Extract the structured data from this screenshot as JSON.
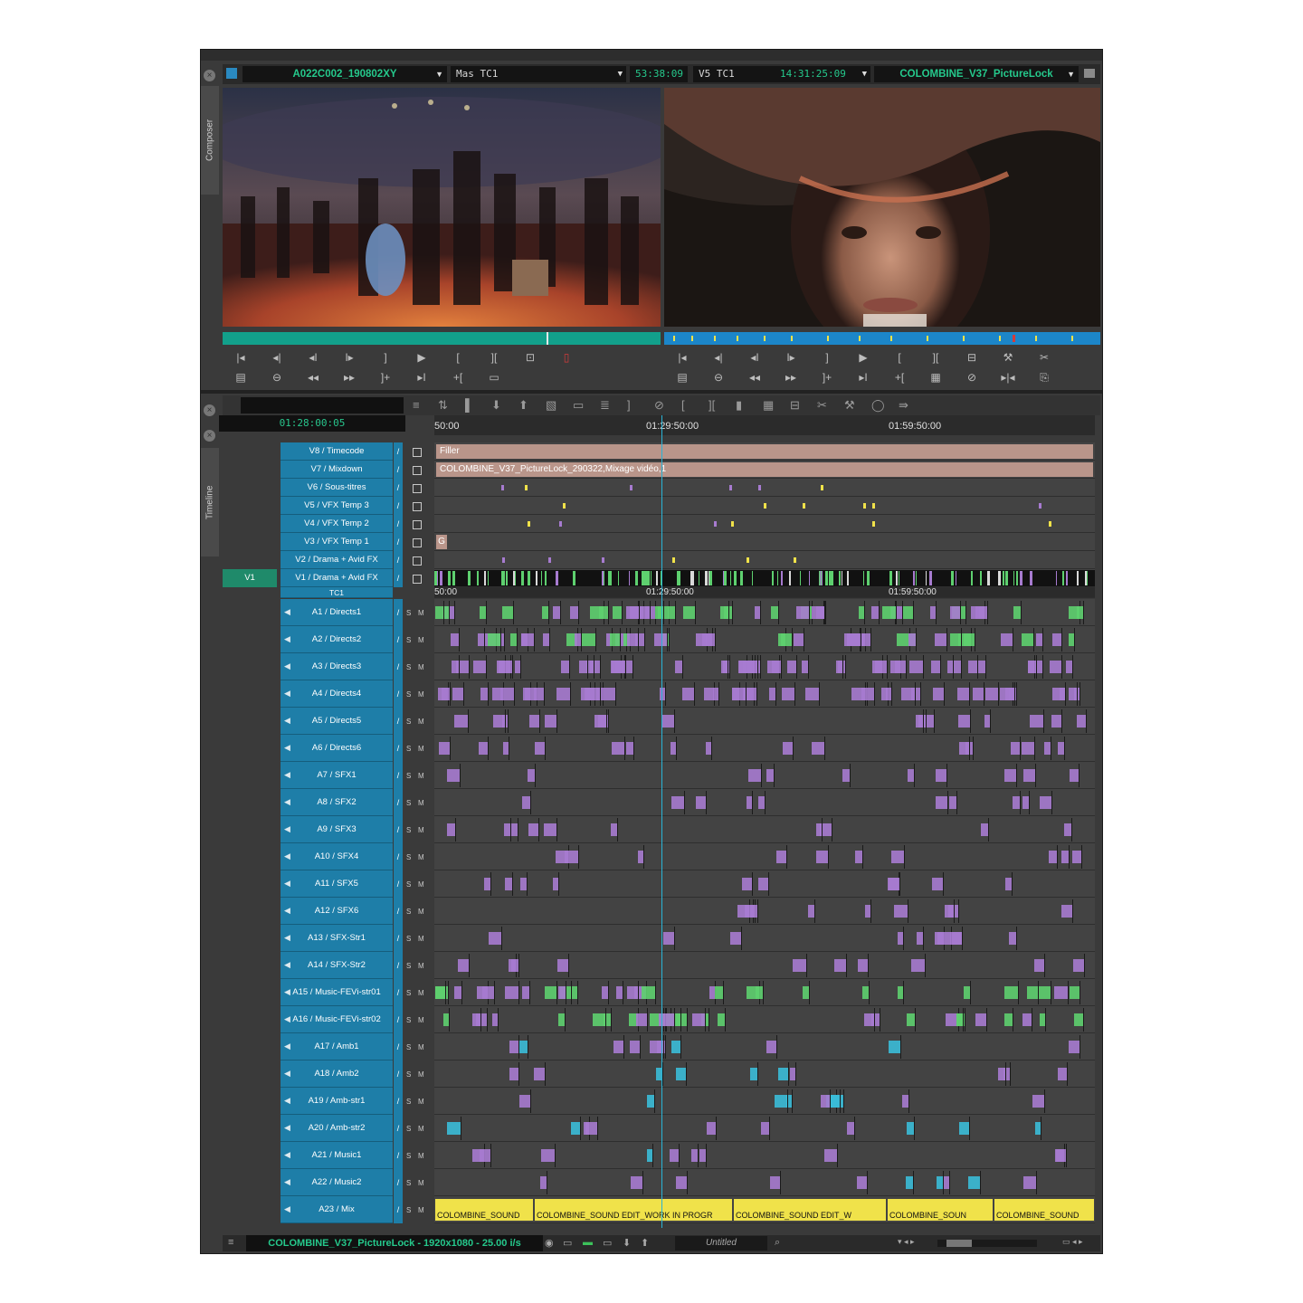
{
  "window": {
    "composer_tab": "Composer",
    "timeline_tab": "Timeline",
    "close_glyph": "×"
  },
  "composer": {
    "source_clip": "A022C002_190802XY",
    "source_tc_mode": "Mas TC1",
    "source_duration": "53:38:09",
    "record_tc_mode": "V5 TC1",
    "record_tc": "14:31:25:09",
    "record_sequence": "COLOMBINE_V37_PictureLock",
    "source_controls_row1": [
      "|◂",
      "◂|",
      "◂I",
      "I▸",
      "]",
      "▶",
      "[",
      "][",
      "⊡",
      "▯"
    ],
    "source_controls_row2": [
      "▤",
      "⊖",
      "◂◂",
      "▸▸",
      "]+",
      "▸I",
      "+[",
      "▭"
    ],
    "record_controls_row1": [
      "|◂",
      "◂|",
      "◂I",
      "I▸",
      "]",
      "▶",
      "[",
      "][",
      "⊟",
      "⚒",
      "✂"
    ],
    "record_controls_row2": [
      "▤",
      "⊖",
      "◂◂",
      "▸▸",
      "]+",
      "▸I",
      "+[",
      "▦",
      "⊘",
      "▸|◂",
      "⎘"
    ]
  },
  "timeline": {
    "current_tc": "01:28:00:05",
    "ruler_labels": [
      "50:00",
      "01:29:50:00",
      "01:59:50:00"
    ],
    "toolbar_icons": [
      "≡",
      "⇅",
      "▌",
      "⬇",
      "⬆",
      "▧",
      "▭",
      "≣",
      "]",
      "⊘",
      "[",
      "][",
      "▮",
      "▦",
      "⊟",
      "✂",
      "⚒",
      "◯",
      "⇛"
    ],
    "video_tracks": [
      {
        "label": "V8 / Timecode",
        "clip": "Filler"
      },
      {
        "label": "V7 / Mixdown",
        "clip": "COLOMBINE_V37_PictureLock_290322,Mixage vidéo,1"
      },
      {
        "label": "V6 / Sous-titres"
      },
      {
        "label": "V5 / VFX Temp 3"
      },
      {
        "label": "V4 / VFX Temp 2"
      },
      {
        "label": "V3 / VFX Temp 1",
        "clip": "G"
      },
      {
        "label": "V2 / Drama + Avid FX"
      },
      {
        "label": "V1 / Drama + Avid FX",
        "source_patch": "V1"
      }
    ],
    "tc_track": "TC1",
    "audio_tracks": [
      "A1 / Directs1",
      "A2 / Directs2",
      "A3 / Directs3",
      "A4 / Directs4",
      "A5 / Directs5",
      "A6 / Directs6",
      "A7 / SFX1",
      "A8 / SFX2",
      "A9 / SFX3",
      "A10 / SFX4",
      "A11 / SFX5",
      "A12 / SFX6",
      "A13 / SFX-Str1",
      "A14 / SFX-Str2",
      "A15 / Music-FEVi-str01",
      "A16 / Music-FEVi-str02",
      "A17 / Amb1",
      "A18 / Amb2",
      "A19 / Amb-str1",
      "A20 / Amb-str2",
      "A21 / Music1",
      "A22 / Music2",
      "A23 / Mix"
    ],
    "solo_label": "S",
    "mute_label": "M",
    "mix_clip_labels": [
      "COLOMBINE_SOUND",
      "COLOMBINE_SOUND EDIT_WORK IN PROGR",
      "COLOMBINE_SOUND EDIT_W",
      "COLOMBINE_SOUN",
      "COLOMBINE_SOUND"
    ],
    "colors": {
      "track_label": "#1e7ea8",
      "timecode_green": "#25c98c",
      "clip_purple": "#a77bd0",
      "clip_green": "#5ed06f",
      "clip_cyan": "#3bbcd8",
      "mix_yellow": "#f0e24a",
      "filler": "#b9958a",
      "cursor": "#2ab4d6"
    }
  },
  "status_bar": {
    "sequence_info": "COLOMBINE_V37_PictureLock - 1920x1080 - 25.00 i/s",
    "bin_name": "Untitled"
  }
}
